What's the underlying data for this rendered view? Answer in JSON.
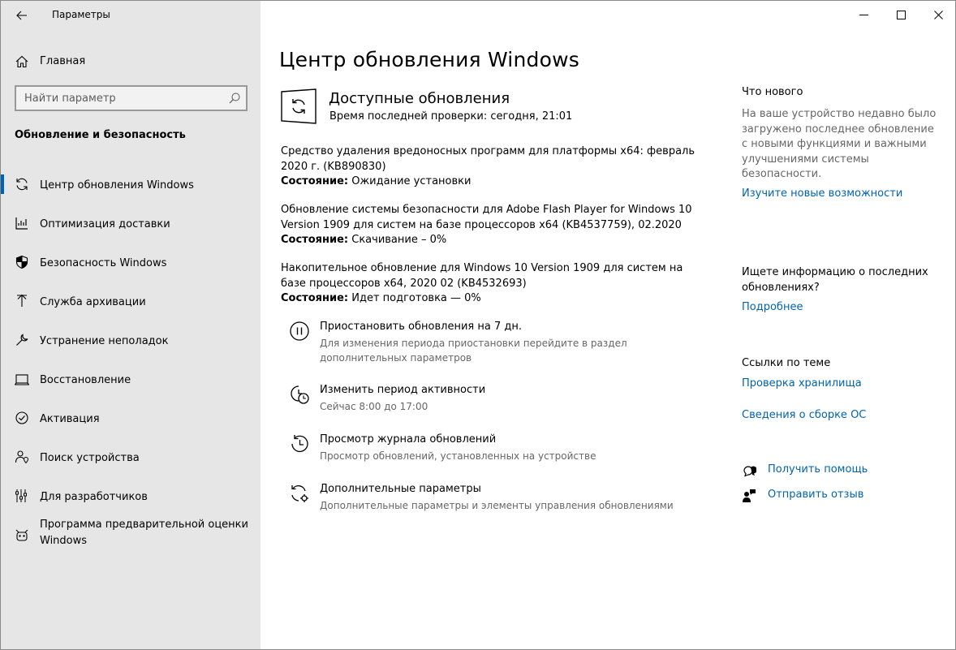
{
  "window": {
    "app_title": "Параметры",
    "back_label": "Назад"
  },
  "sidebar": {
    "home_label": "Главная",
    "search_placeholder": "Найти параметр",
    "section_title": "Обновление и безопасность",
    "items": [
      {
        "label": "Центр обновления Windows",
        "icon": "sync-icon",
        "active": true
      },
      {
        "label": "Оптимизация доставки",
        "icon": "delivery-icon"
      },
      {
        "label": "Безопасность Windows",
        "icon": "shield-icon"
      },
      {
        "label": "Служба архивации",
        "icon": "backup-icon"
      },
      {
        "label": "Устранение неполадок",
        "icon": "wrench-icon"
      },
      {
        "label": "Восстановление",
        "icon": "recovery-icon"
      },
      {
        "label": "Активация",
        "icon": "check-circle-icon"
      },
      {
        "label": "Поиск устройства",
        "icon": "person-location-icon"
      },
      {
        "label": "Для разработчиков",
        "icon": "developer-icon"
      },
      {
        "label": "Программа предварительной оценки Windows",
        "icon": "insider-icon"
      }
    ]
  },
  "main": {
    "title": "Центр обновления Windows",
    "available_title": "Доступные обновления",
    "last_check": "Время последней проверки: сегодня, 21:01",
    "status_label": "Состояние:",
    "updates": [
      {
        "name": "Средство удаления вредоносных программ для платформы x64: февраль 2020 г. (KB890830)",
        "status": " Ожидание установки"
      },
      {
        "name": "Обновление системы безопасности для Adobe Flash Player for Windows 10 Version 1909 для систем на базе процессоров x64 (KB4537759), 02.2020",
        "status": " Скачивание – 0%"
      },
      {
        "name": "Накопительное обновление для Windows 10 Version 1909 для систем на базе процессоров x64, 2020 02 (KB4532693)",
        "status": " Идет подготовка — 0%"
      }
    ],
    "options": [
      {
        "title": "Приостановить обновления на 7 дн.",
        "desc": "Для изменения периода приостановки перейдите в раздел дополнительных параметров",
        "icon": "pause-icon"
      },
      {
        "title": "Изменить период активности",
        "desc": "Сейчас 8:00 до 17:00",
        "icon": "active-hours-icon"
      },
      {
        "title": "Просмотр журнала обновлений",
        "desc": "Просмотр обновлений, установленных на устройстве",
        "icon": "history-icon"
      },
      {
        "title": "Дополнительные параметры",
        "desc": "Дополнительные параметры и элементы управления обновлениями",
        "icon": "advanced-options-icon"
      }
    ]
  },
  "right": {
    "whats_new_title": "Что нового",
    "whats_new_text": "На ваше устройство недавно было загружено последнее обновление с новыми функциями и важными улучшениями системы безопасности.",
    "whats_new_link": "Изучите новые возможности",
    "info_title": "Ищете информацию о последних обновлениях?",
    "info_link": "Подробнее",
    "related_title": "Ссылки по теме",
    "related_links": [
      "Проверка хранилища",
      "Сведения о сборке ОС"
    ],
    "help_link": "Получить помощь",
    "feedback_link": "Отправить отзыв"
  },
  "colors": {
    "accent": "#0063b1",
    "sidebar_bg": "#e6e6e6"
  }
}
